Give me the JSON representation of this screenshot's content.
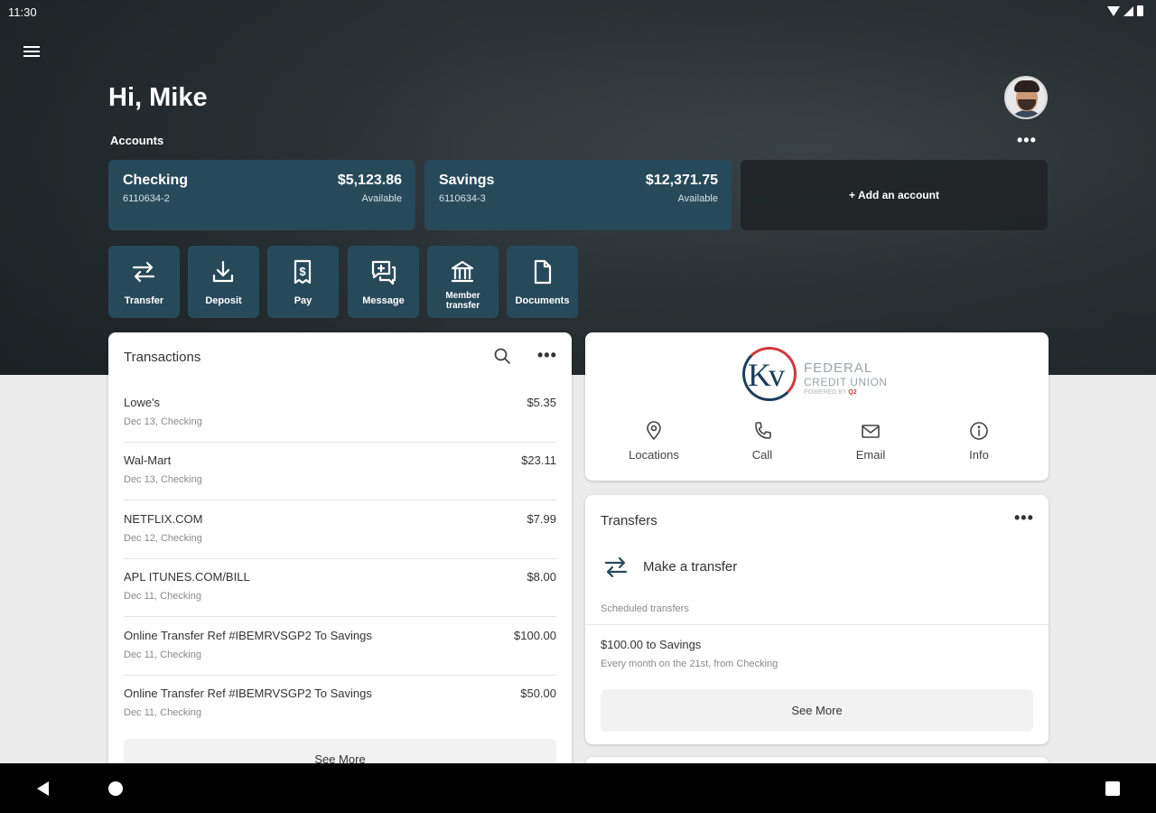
{
  "status_bar": {
    "time": "11:30"
  },
  "header": {
    "greeting": "Hi, Mike",
    "accounts_label": "Accounts",
    "more": "•••"
  },
  "accounts": [
    {
      "name": "Checking",
      "number": "6110634-2",
      "balance": "$5,123.86",
      "balance_label": "Available"
    },
    {
      "name": "Savings",
      "number": "6110634-3",
      "balance": "$12,371.75",
      "balance_label": "Available"
    }
  ],
  "add_account": "+ Add an account",
  "quick_actions": [
    {
      "label": "Transfer",
      "icon": "transfer-icon"
    },
    {
      "label": "Deposit",
      "icon": "download-icon"
    },
    {
      "label": "Pay",
      "icon": "bill-icon"
    },
    {
      "label": "Message",
      "icon": "message-icon"
    },
    {
      "label": "Member transfer",
      "icon": "bank-icon"
    },
    {
      "label": "Documents",
      "icon": "document-icon"
    }
  ],
  "transactions": {
    "title": "Transactions",
    "more": "•••",
    "items": [
      {
        "description": "Lowe's",
        "meta": "Dec 13, Checking",
        "amount": "$5.35"
      },
      {
        "description": "Wal-Mart",
        "meta": "Dec 13, Checking",
        "amount": "$23.11"
      },
      {
        "description": "NETFLIX.COM",
        "meta": "Dec 12, Checking",
        "amount": "$7.99"
      },
      {
        "description": "APL ITUNES.COM/BILL",
        "meta": "Dec 11, Checking",
        "amount": "$8.00"
      },
      {
        "description": "Online Transfer Ref #IBEMRVSGP2 To Savings",
        "meta": "Dec 11, Checking",
        "amount": "$100.00"
      },
      {
        "description": "Online Transfer Ref #IBEMRVSGP2 To Savings",
        "meta": "Dec 11, Checking",
        "amount": "$50.00"
      }
    ],
    "see_more": "See More"
  },
  "credit_union": {
    "logo_mark": "Kv",
    "logo_line1": "FEDERAL",
    "logo_line2": "CREDIT UNION",
    "logo_tagline_prefix": "POWERED BY",
    "logo_tagline_brand": "Q2",
    "actions": [
      {
        "label": "Locations",
        "icon": "location-pin-icon"
      },
      {
        "label": "Call",
        "icon": "phone-icon"
      },
      {
        "label": "Email",
        "icon": "email-icon"
      },
      {
        "label": "Info",
        "icon": "info-icon"
      }
    ],
    "colors": {
      "navy": "#1d3d5c",
      "red": "#d2373c"
    }
  },
  "transfers": {
    "title": "Transfers",
    "more": "•••",
    "make_transfer": "Make a transfer",
    "scheduled_label": "Scheduled transfers",
    "scheduled": [
      {
        "title": "$100.00 to Savings",
        "subtitle": "Every month on the 21st, from Checking"
      }
    ],
    "see_more": "See More"
  },
  "colors": {
    "account_card": "#274a5a",
    "background": "#ebebeb"
  }
}
